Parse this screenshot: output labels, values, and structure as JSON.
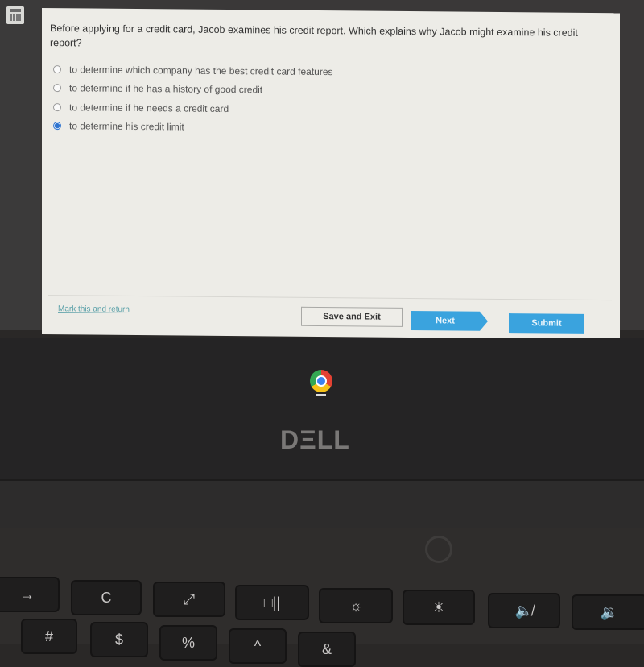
{
  "toolbar": {
    "calculator_icon": "calculator-icon"
  },
  "question": {
    "text": "Before applying for a credit card, Jacob examines his credit report. Which explains why Jacob might examine his credit report?",
    "options": [
      {
        "label": "to determine which company has the best credit card features",
        "selected": false
      },
      {
        "label": "to determine if he has a history of good credit",
        "selected": false
      },
      {
        "label": "to determine if he needs a credit card",
        "selected": false
      },
      {
        "label": "to determine his credit limit",
        "selected": true
      }
    ]
  },
  "footer": {
    "mark_link": "Mark this and return",
    "save_label": "Save and Exit",
    "next_label": "Next",
    "submit_label": "Submit"
  },
  "colors": {
    "accent": "#3aa3de",
    "selected_radio": "#2f74d0",
    "link": "#5aa0a8"
  },
  "shelf": {
    "app_icon": "chrome-icon"
  },
  "laptop": {
    "brand": "DΞLL"
  },
  "keyboard": {
    "top_row": [
      "→",
      "C",
      "⤢",
      "□||",
      "☼",
      "☀",
      "🔈̸",
      "🔉"
    ],
    "second_row": [
      "#",
      "$",
      "%",
      "^",
      "&"
    ]
  }
}
